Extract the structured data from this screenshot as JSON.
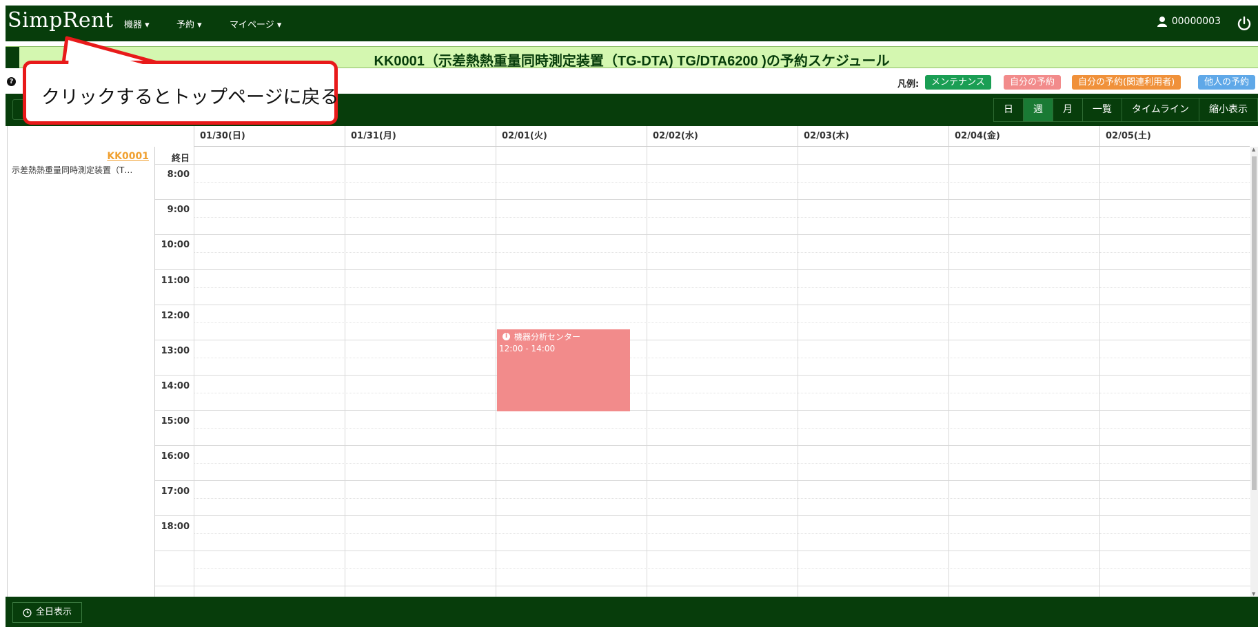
{
  "navbar": {
    "brand": "SimpRent",
    "menus": [
      {
        "label": "機器 ▾"
      },
      {
        "label": "予約 ▾"
      },
      {
        "label": "マイページ ▾"
      }
    ],
    "user_id": "00000003",
    "user_icon": "user-icon",
    "logout_icon": "power-icon"
  },
  "page": {
    "title": "KK0001（示差熱熱重量同時測定装置（TG-DTA) TG/DTA6200 )の予約スケジュール"
  },
  "legend": {
    "label": "凡例:",
    "items": [
      {
        "label": "メンテナンス",
        "color": "#1a9e54"
      },
      {
        "label": "自分の予約",
        "color": "#f28b8b"
      },
      {
        "label": "自分の予約(関連利用者)",
        "color": "#f0913a"
      },
      {
        "label": "他人の予約",
        "color": "#5fa8e8"
      }
    ]
  },
  "toolbar": {
    "views": [
      {
        "label": "日",
        "active": false
      },
      {
        "label": "週",
        "active": true
      },
      {
        "label": "月",
        "active": false
      },
      {
        "label": "一覧",
        "active": false
      },
      {
        "label": "タイムライン",
        "active": false
      },
      {
        "label": "縮小表示",
        "active": false
      }
    ]
  },
  "calendar": {
    "dates": [
      "01/30(日)",
      "01/31(月)",
      "02/01(火)",
      "02/02(水)",
      "02/03(木)",
      "02/04(金)",
      "02/05(土)"
    ],
    "allday_label": "終日",
    "times": [
      "8:00",
      "9:00",
      "10:00",
      "11:00",
      "12:00",
      "13:00",
      "14:00",
      "15:00",
      "16:00",
      "17:00",
      "18:00"
    ],
    "resource": {
      "code": "KK0001",
      "name": "示差熱熱重量同時測定装置（T…"
    },
    "events": [
      {
        "title": "機器分析センター",
        "time": "12:00 - 14:00",
        "day": "02/01(火)",
        "color": "#f28b8b"
      }
    ]
  },
  "footer": {
    "allday_button": "全日表示"
  },
  "callout": {
    "text": "クリックするとトップページに戻る",
    "border_color": "#e81a1a"
  }
}
